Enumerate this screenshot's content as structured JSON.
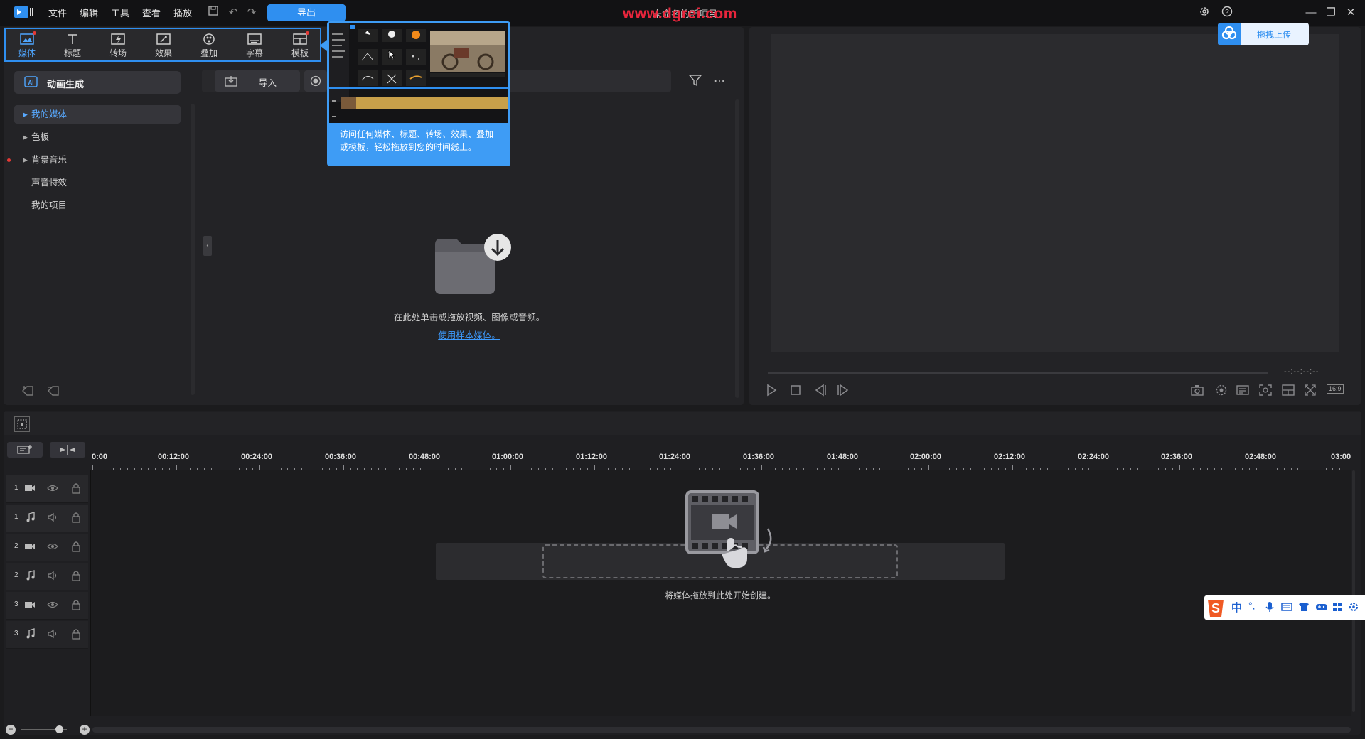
{
  "titlebar": {
    "menu": [
      "文件",
      "编辑",
      "工具",
      "查看",
      "播放"
    ],
    "export_label": "导出",
    "project_title": "未命名的新项目",
    "watermark": "www.dgrei.com"
  },
  "tabs": [
    {
      "label": "媒体",
      "icon": "media-icon",
      "active": true
    },
    {
      "label": "标题",
      "icon": "title-icon"
    },
    {
      "label": "转场",
      "icon": "transition-icon"
    },
    {
      "label": "效果",
      "icon": "effect-icon"
    },
    {
      "label": "叠加",
      "icon": "overlay-icon"
    },
    {
      "label": "字幕",
      "icon": "subtitle-icon"
    },
    {
      "label": "模板",
      "icon": "template-icon"
    }
  ],
  "sidebar": {
    "ai_label": "动画生成",
    "items": [
      {
        "label": "我的媒体",
        "selected": true
      },
      {
        "label": "色板"
      },
      {
        "label": "背景音乐"
      },
      {
        "label": "声音特效"
      },
      {
        "label": "我的项目"
      }
    ]
  },
  "media": {
    "import_label": "导入",
    "drop_hint": "在此处单击或拖放视频、图像或音频。",
    "sample_link": "使用样本媒体。"
  },
  "tooltip": {
    "text": "访问任何媒体、标题、转场、效果、叠加或模板，轻松拖放到您的时间线上。"
  },
  "preview": {
    "timecode": "--:--:--:--",
    "ratio": "16:9",
    "upload_label": "拖拽上传"
  },
  "timeline": {
    "ruler": [
      "0:00",
      "00:12:00",
      "00:24:00",
      "00:36:00",
      "00:48:00",
      "01:00:00",
      "01:12:00",
      "01:24:00",
      "01:36:00",
      "01:48:00",
      "02:00:00",
      "02:12:00",
      "02:24:00",
      "02:36:00",
      "02:48:00",
      "03:00"
    ],
    "tracks": [
      {
        "num": "1",
        "type": "video"
      },
      {
        "num": "1",
        "type": "audio"
      },
      {
        "num": "2",
        "type": "video"
      },
      {
        "num": "2",
        "type": "audio"
      },
      {
        "num": "3",
        "type": "video"
      },
      {
        "num": "3",
        "type": "audio"
      }
    ],
    "drop_hint": "将媒体拖放到此处开始创建。"
  },
  "ime": {
    "lang": "中"
  },
  "colors": {
    "accent": "#2f8ff0",
    "watermark": "#e8253c"
  }
}
